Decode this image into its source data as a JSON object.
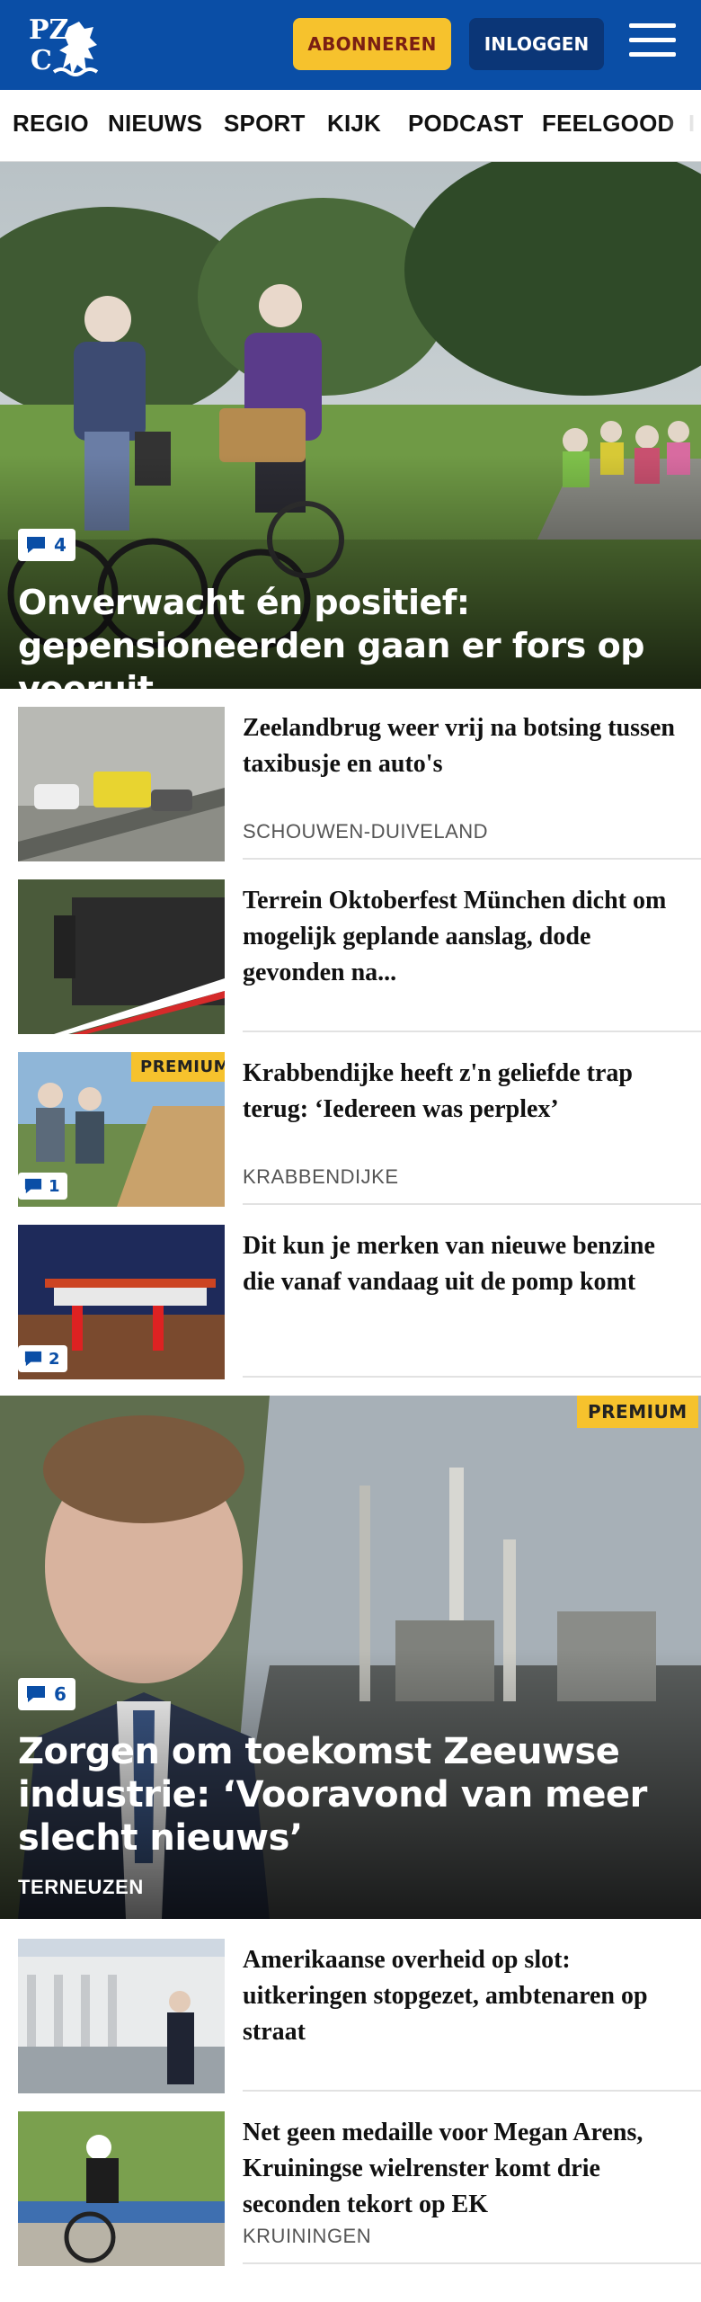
{
  "header": {
    "logo_line1": "PZ",
    "logo_line2": "C",
    "subscribe_label": "ABONNEREN",
    "login_label": "INLOGGEN",
    "menu_icon": "hamburger-menu-icon",
    "brand_color": "#0a4ea6",
    "accent_color": "#f6c22d"
  },
  "nav": {
    "items": [
      "REGIO",
      "NIEUWS",
      "SPORT",
      "KIJK",
      "PODCAST",
      "FEELGOOD",
      "I"
    ]
  },
  "hero": {
    "comments": "4",
    "title": "Onverwacht én positief: gepensio­neerden gaan er fors op vooruit"
  },
  "articles": [
    {
      "title": "Zeelandbrug weer vrij na botsing tussen taxibusje en auto's",
      "location": "SCHOUWEN-DUIVELAND"
    },
    {
      "title": "Terrein Oktoberfest München dicht om mogelijk geplande aanslag, dode gevonden na..."
    },
    {
      "title": "Krabbendijke heeft z'n geliefde trap terug: ‘Iedereen was perplex’",
      "location": "KRABBENDIJKE",
      "premium": "PREMIUM",
      "comments": "1"
    },
    {
      "title": "Dit kun je merken van nieuwe benzine die vanaf vandaag uit de pomp komt",
      "comments": "2"
    }
  ],
  "hero2": {
    "premium": "PREMIUM",
    "comments": "6",
    "title": "Zorgen om toekomst Zeeuwse industrie: ‘Vooravond van meer slecht nieuws’",
    "location": "TERNEUZEN"
  },
  "articles2": [
    {
      "title": "Amerikaanse overheid op slot: uitkeringen stopgezet, ambtenaren op straat"
    },
    {
      "title": "Net geen medaille voor Megan Arens, Kruiningse wielrenster komt drie seconden tekort op EK",
      "location": "KRUININGEN"
    }
  ]
}
